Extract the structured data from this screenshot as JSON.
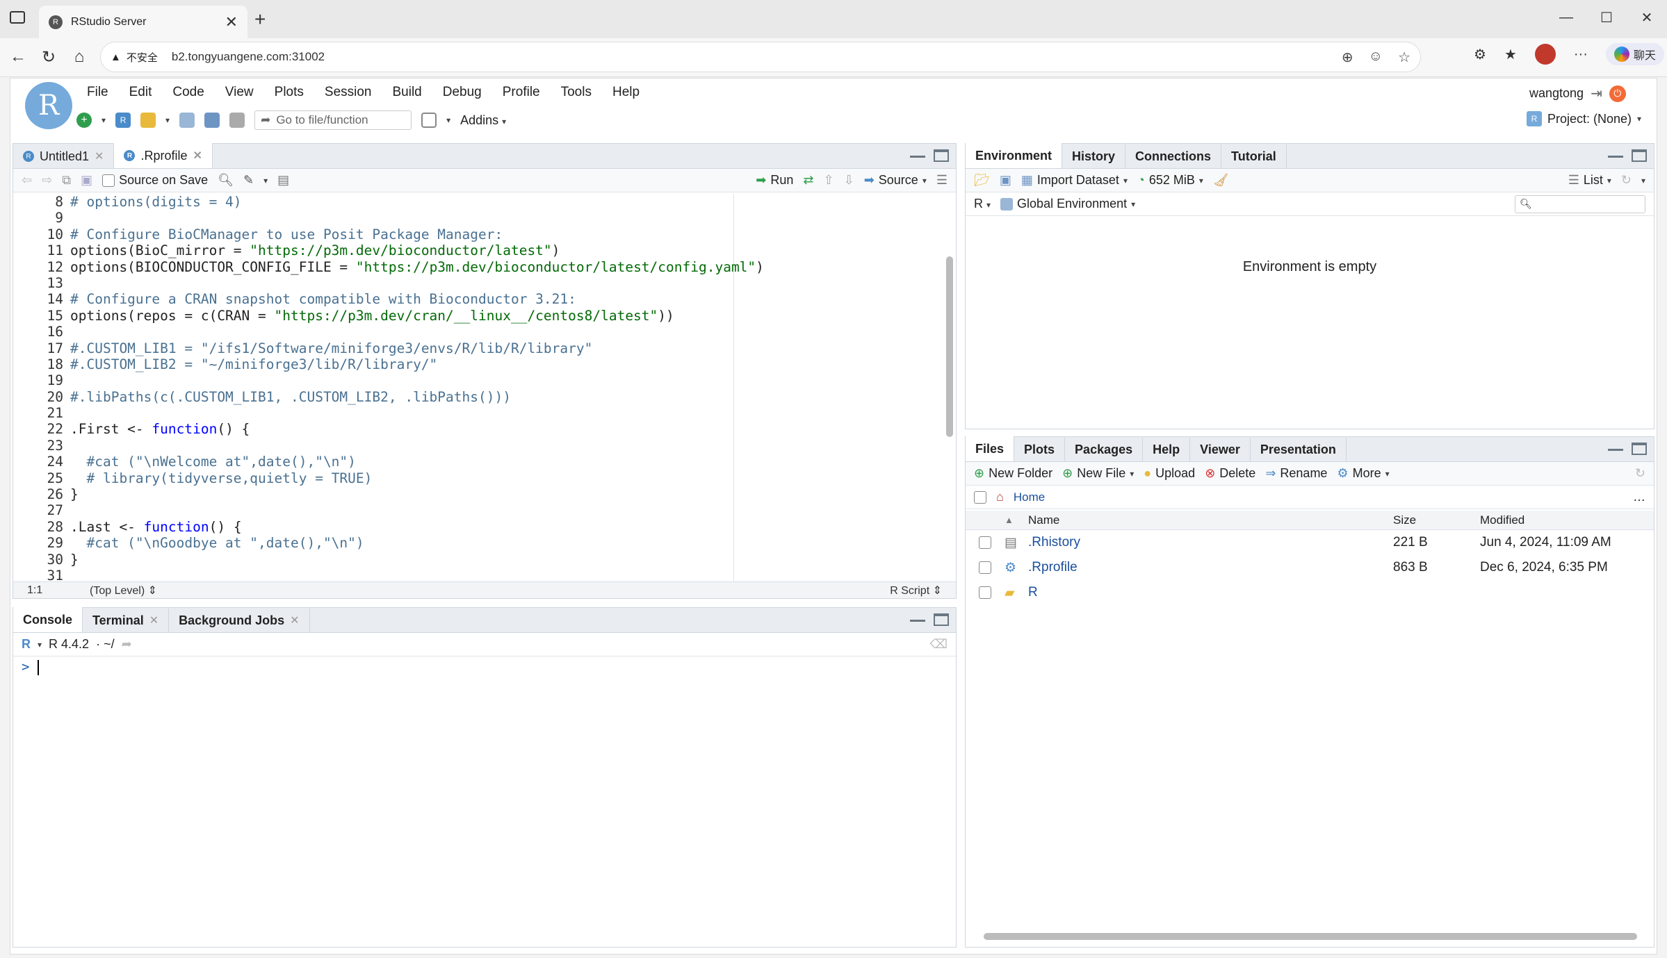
{
  "browser": {
    "tab_title": "RStudio Server",
    "tab_favicon": "R",
    "security_label": "不安全",
    "url": "b2.tongyuangene.com:31002",
    "chat_label": "聊天"
  },
  "rstudio": {
    "logo_letter": "R",
    "menu": [
      "File",
      "Edit",
      "Code",
      "View",
      "Plots",
      "Session",
      "Build",
      "Debug",
      "Profile",
      "Tools",
      "Help"
    ],
    "goto_placeholder": "Go to file/function",
    "addins_label": "Addins",
    "username": "wangtong",
    "project_label": "Project: (None)"
  },
  "editor": {
    "tabs": [
      {
        "label": "Untitled1",
        "active": false
      },
      {
        "label": ".Rprofile",
        "active": true
      }
    ],
    "source_on_save": "Source on Save",
    "run_label": "Run",
    "source_label": "Source",
    "line_numbers": [
      "8",
      "9",
      "10",
      "11",
      "12",
      "13",
      "14",
      "15",
      "16",
      "17",
      "18",
      "19",
      "20",
      "21",
      "22",
      "23",
      "24",
      "25",
      "26",
      "27",
      "28",
      "29",
      "30",
      "31"
    ],
    "lines": [
      "# options(digits = 4)",
      "",
      "# Configure BioCManager to use Posit Package Manager:",
      "options(BioC_mirror = \"https://p3m.dev/bioconductor/latest\")",
      "options(BIOCONDUCTOR_CONFIG_FILE = \"https://p3m.dev/bioconductor/latest/config.yaml\")",
      "",
      "# Configure a CRAN snapshot compatible with Bioconductor 3.21:",
      "options(repos = c(CRAN = \"https://p3m.dev/cran/__linux__/centos8/latest\"))",
      "",
      "#.CUSTOM_LIB1 = \"/ifs1/Software/miniforge3/envs/R/lib/R/library\"",
      "#.CUSTOM_LIB2 = \"~/miniforge3/lib/R/library/\"",
      "",
      "#.libPaths(c(.CUSTOM_LIB1, .CUSTOM_LIB2, .libPaths()))",
      "",
      ".First <- function() {",
      "",
      "  #cat (\"\\nWelcome at\",date(),\"\\n\")",
      "  # library(tidyverse,quietly = TRUE)",
      "}",
      "",
      ".Last <- function() {",
      "  #cat (\"\\nGoodbye at \",date(),\"\\n\")",
      "}",
      ""
    ],
    "status_pos": "1:1",
    "status_scope": "(Top Level) ⇕",
    "status_type": "R Script ⇕"
  },
  "console": {
    "tabs": [
      {
        "label": "Console",
        "active": true
      },
      {
        "label": "Terminal",
        "active": false
      },
      {
        "label": "Background Jobs",
        "active": false
      }
    ],
    "r_version": "R 4.4.2",
    "path": "· ~/",
    "prompt": ">"
  },
  "environment": {
    "tabs": [
      {
        "label": "Environment",
        "active": true
      },
      {
        "label": "History",
        "active": false
      },
      {
        "label": "Connections",
        "active": false
      },
      {
        "label": "Tutorial",
        "active": false
      }
    ],
    "import_label": "Import Dataset",
    "memory_label": "652 MiB",
    "list_label": "List",
    "lang_label": "R",
    "scope_label": "Global Environment",
    "empty_message": "Environment is empty"
  },
  "files": {
    "tabs": [
      {
        "label": "Files",
        "active": true
      },
      {
        "label": "Plots",
        "active": false
      },
      {
        "label": "Packages",
        "active": false
      },
      {
        "label": "Help",
        "active": false
      },
      {
        "label": "Viewer",
        "active": false
      },
      {
        "label": "Presentation",
        "active": false
      }
    ],
    "actions": {
      "new_folder": "New Folder",
      "new_file": "New File",
      "upload": "Upload",
      "delete": "Delete",
      "rename": "Rename",
      "more": "More"
    },
    "breadcrumb": "Home",
    "columns": {
      "name": "Name",
      "size": "Size",
      "modified": "Modified"
    },
    "rows": [
      {
        "name": ".Rhistory",
        "size": "221 B",
        "modified": "Jun 4, 2024, 11:09 AM",
        "icon": "text-file-icon"
      },
      {
        "name": ".Rprofile",
        "size": "863 B",
        "modified": "Dec 6, 2024, 6:35 PM",
        "icon": "r-settings-file-icon"
      },
      {
        "name": "R",
        "size": "",
        "modified": "",
        "icon": "folder-icon"
      }
    ]
  },
  "colors": {
    "accent": "#75aadb",
    "comment": "#4a7191",
    "string": "#036a07",
    "keyword": "#0000ff",
    "link": "#1a4f9c"
  }
}
